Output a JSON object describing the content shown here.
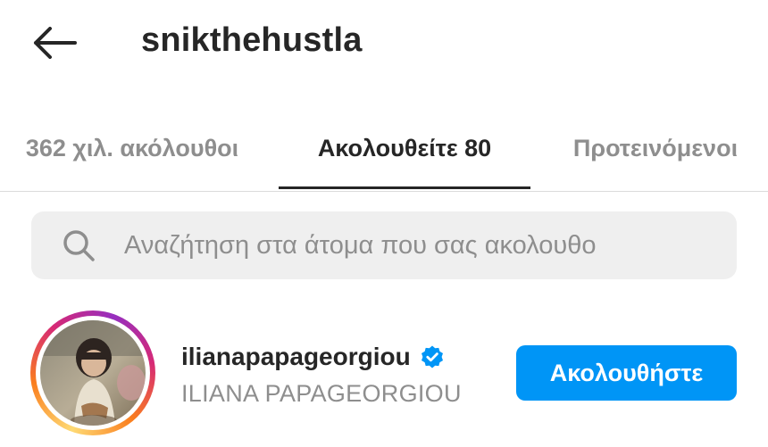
{
  "header": {
    "back_icon": "arrow-left-icon",
    "title": "snikthehustla"
  },
  "tabs": [
    {
      "label": "362 χιλ. ακόλουθοι",
      "active": false
    },
    {
      "label": "Ακολουθείτε 80",
      "active": true
    },
    {
      "label": "Προτεινόμενοι",
      "active": false
    }
  ],
  "search": {
    "icon": "search-icon",
    "placeholder": "Αναζήτηση στα άτομα που σας ακολουθο",
    "value": ""
  },
  "users": [
    {
      "username": "ilianapapageorgiou",
      "verified": true,
      "full_name": "ILIANA PAPAGEORGIOU",
      "action_label": "Ακολουθήστε",
      "has_story": true
    }
  ],
  "colors": {
    "accent": "#0095f6",
    "text_primary": "#262626",
    "text_secondary": "#8e8e8e",
    "search_bg": "#efefef",
    "divider": "#dbdbdb"
  }
}
